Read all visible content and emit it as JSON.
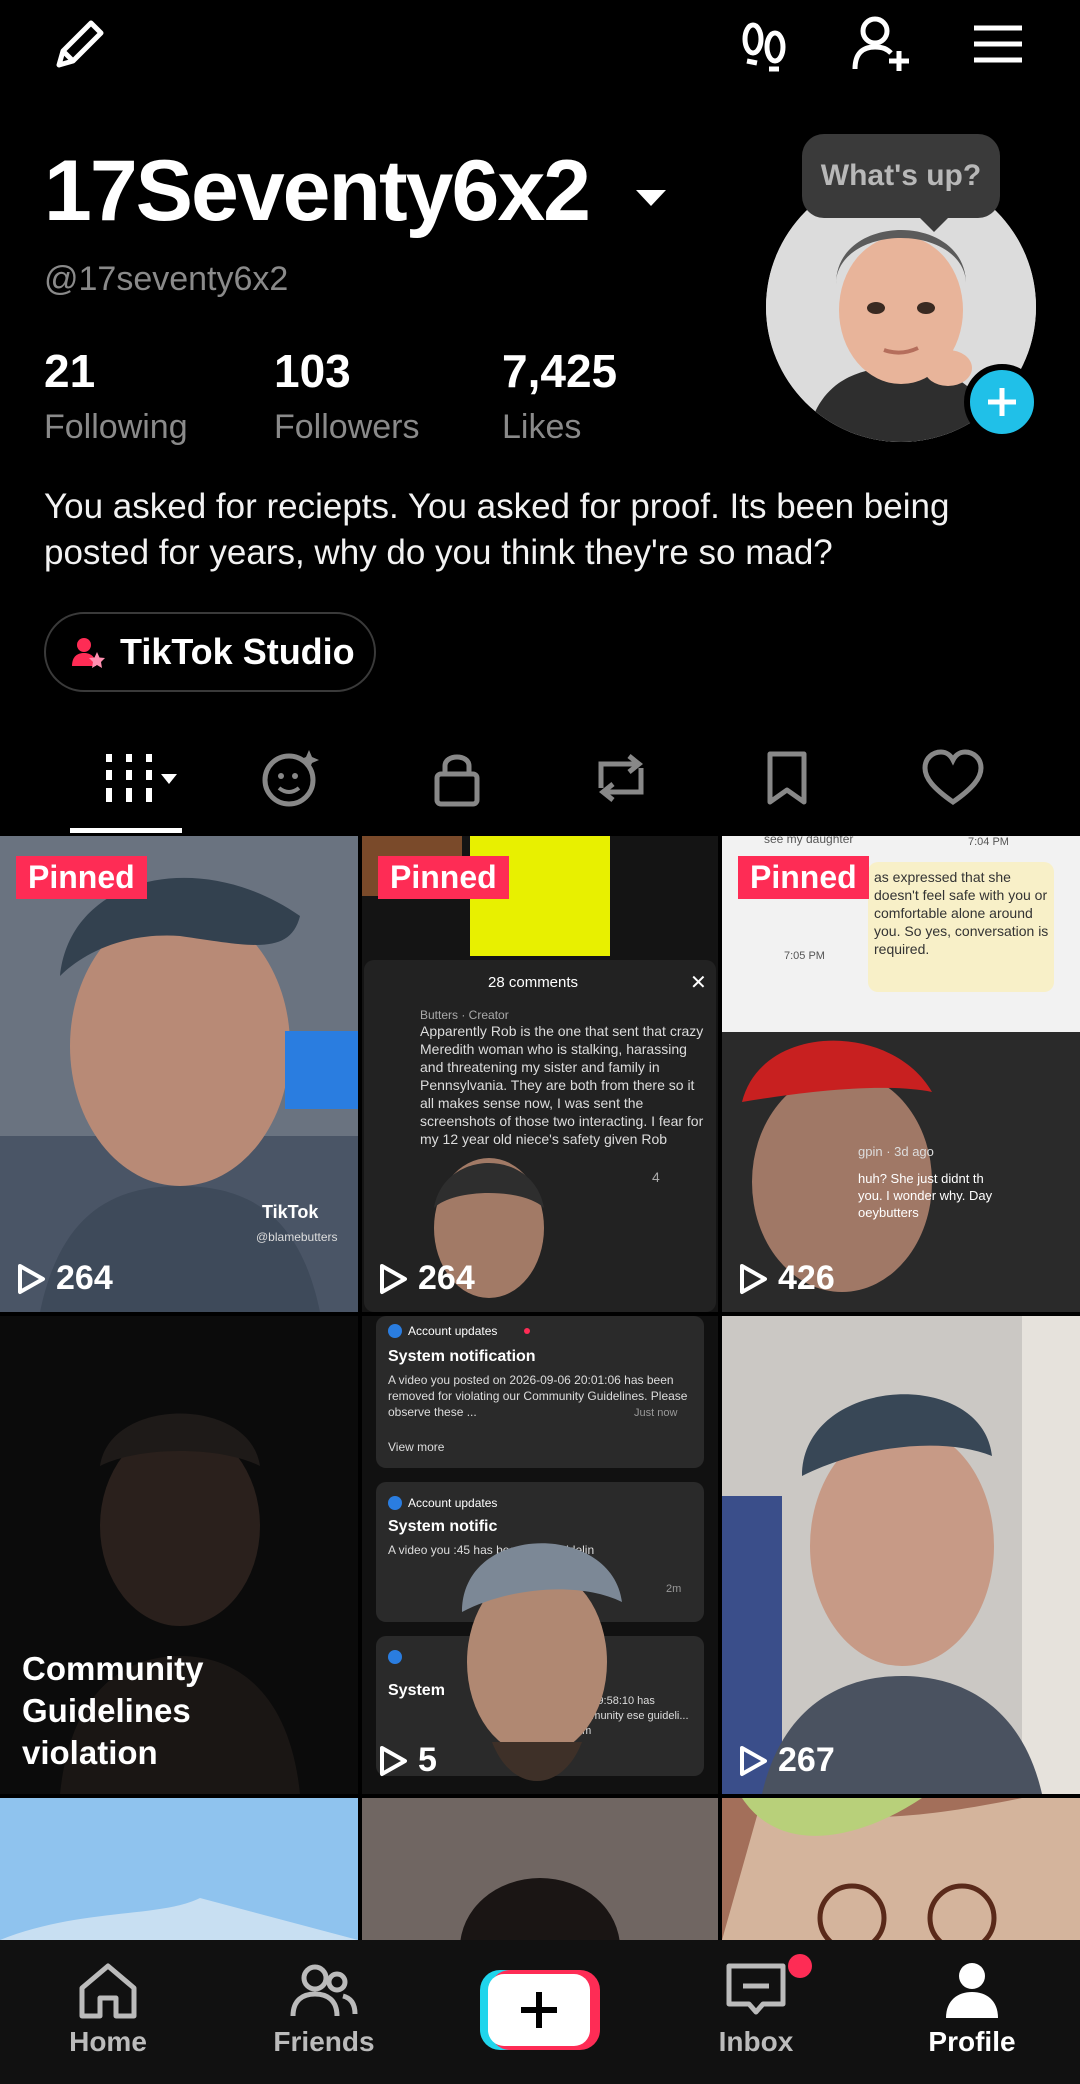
{
  "profile": {
    "username": "17Seventy6x2",
    "handle": "@17seventy6x2",
    "stats": [
      {
        "value": "21",
        "label": "Following"
      },
      {
        "value": "103",
        "label": "Followers"
      },
      {
        "value": "7,425",
        "label": "Likes"
      }
    ],
    "bio": "You asked for reciepts. You asked for proof. Its been being posted for years, why do you think they're so mad?",
    "studio_label": "TikTok Studio",
    "avatar_bubble": "What's up?"
  },
  "tabs": [
    "videos-tab",
    "reposts-ai-tab",
    "private-tab",
    "reposts-tab",
    "saved-tab",
    "liked-tab"
  ],
  "grid": [
    {
      "pinned": "Pinned",
      "views": "264"
    },
    {
      "pinned": "Pinned",
      "views": "264"
    },
    {
      "pinned": "Pinned",
      "views": "426"
    },
    {
      "overlay": "Community Guidelines violation"
    },
    {
      "views": "5"
    },
    {
      "views": "267"
    }
  ],
  "grid_thumb_text": {
    "c1_watermark": "TikTok",
    "c1_watermark_sub": "@blamebutters",
    "c2_comments": "28 comments",
    "c2_author": "Butters · Creator",
    "c2_comment": "Apparently Rob is the one that sent that crazy Meredith woman who is stalking, harassing and threatening my sister and family in Pennsylvania. They are both from there so it all makes sense now, I was sent the screenshots of those two interacting. I fear for my 12 year old niece's safety given Rob",
    "c2_likes": "4",
    "c3_top": "see my daughter",
    "c3_time1": "7:04 PM",
    "c3_msg": "as expressed that she doesn't feel safe with you or comfortable alone around you. So yes, conversation is required.",
    "c3_time2": "7:05 PM",
    "c3_caption": "huh? She just didnt th you. I wonder why. Day oeybutters",
    "c3_user": "gpin · 3d ago",
    "c5_header": "Account updates",
    "c5_title": "System notification",
    "c5_body": "A video you posted on 2026-09-06 20:01:06 has been removed for violating our Community Guidelines. Please observe these ...",
    "c5_time": "Just now",
    "c5_viewmore": "View more",
    "c5_header2": "Account updates",
    "c5_title2": "System notific",
    "c5_body2": "A video you :45 has been rem Guidelin",
    "c5_time2": "2m",
    "c5_title3": "System",
    "c5_body3": "06 19:58:10 has ommunity ese guideli... 3m"
  },
  "nav": [
    {
      "label": "Home",
      "icon": "home-icon"
    },
    {
      "label": "Friends",
      "icon": "friends-icon"
    },
    {
      "label": "",
      "icon": "create-icon"
    },
    {
      "label": "Inbox",
      "icon": "inbox-icon"
    },
    {
      "label": "Profile",
      "icon": "profile-icon"
    }
  ],
  "colors": {
    "accent": "#fe2c55",
    "cyan": "#20c0e8",
    "muted": "#8a8a8a"
  }
}
